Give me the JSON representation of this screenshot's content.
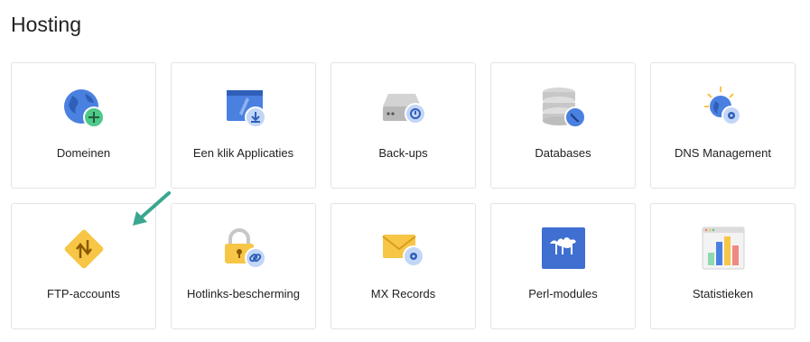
{
  "page": {
    "title": "Hosting"
  },
  "tiles": [
    {
      "label": "Domeinen",
      "icon": "globe-add-icon"
    },
    {
      "label": "Een klik Applicaties",
      "icon": "app-folder-icon"
    },
    {
      "label": "Back-ups",
      "icon": "backup-drive-icon"
    },
    {
      "label": "Databases",
      "icon": "database-icon"
    },
    {
      "label": "DNS Management",
      "icon": "dns-globe-icon"
    },
    {
      "label": "FTP-accounts",
      "icon": "ftp-transfer-icon"
    },
    {
      "label": "Hotlinks-bescherming",
      "icon": "lock-link-icon"
    },
    {
      "label": "MX Records",
      "icon": "mail-settings-icon"
    },
    {
      "label": "Perl-modules",
      "icon": "perl-camel-icon"
    },
    {
      "label": "Statistieken",
      "icon": "bar-chart-icon"
    }
  ],
  "colors": {
    "blue": "#4a80e0",
    "light_blue": "#c3d6f7",
    "green": "#4fc88a",
    "yellow": "#f7c647",
    "gray": "#c7c7c7",
    "arrow": "#3aa68f"
  }
}
